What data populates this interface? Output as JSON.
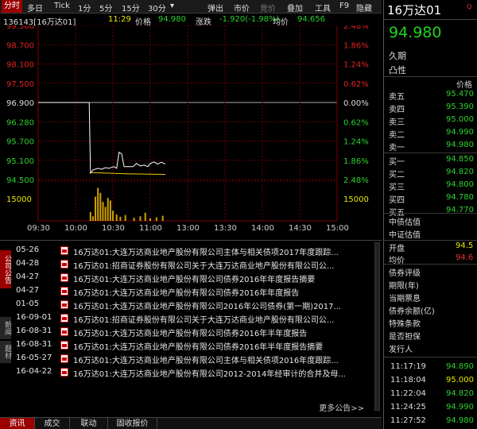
{
  "toolbar": {
    "left": [
      {
        "label": "分时",
        "active": true
      },
      {
        "label": "多日"
      },
      {
        "label": "Tick"
      },
      {
        "label": "1分"
      },
      {
        "label": "5分"
      },
      {
        "label": "15分"
      },
      {
        "label": "30分"
      }
    ],
    "dropdown_symbol": "▾",
    "right": [
      {
        "label": "弹出"
      },
      {
        "label": "市价"
      },
      {
        "label": "竞价"
      },
      {
        "label": "叠加"
      },
      {
        "label": "工具"
      },
      {
        "label": "F9"
      },
      {
        "label": "隐藏"
      }
    ]
  },
  "info": {
    "code": "136143[16万达01]",
    "time": "11:29",
    "price_label": "价格",
    "price_value": "94.980",
    "change_label": "涨跌",
    "change_value": "-1.920(-1.98%)",
    "avg_label": "均价",
    "avg_value": "94.656"
  },
  "chart_data": {
    "type": "line",
    "title": "",
    "x_ticks": [
      "09:30",
      "10:00",
      "10:30",
      "11:00",
      "13:00",
      "13:30",
      "14:00",
      "14:30",
      "15:00"
    ],
    "y_left_ticks": [
      "99.300",
      "98.700",
      "98.100",
      "97.500",
      "96.900",
      "96.280",
      "95.700",
      "95.100",
      "94.500"
    ],
    "y_right_ticks": [
      "2.48%",
      "1.86%",
      "1.24%",
      "0.62%",
      "0.00%",
      "0.62%",
      "1.24%",
      "1.86%",
      "2.48%"
    ],
    "volume_ticks": [
      "15000",
      "15000"
    ],
    "prev_close": 96.9,
    "ylim": [
      94.5,
      99.3
    ],
    "price_series": [
      {
        "t": "09:30",
        "v": 96.9
      },
      {
        "t": "10:11",
        "v": 96.9
      },
      {
        "t": "10:12",
        "v": 94.7
      },
      {
        "t": "10:14",
        "v": 94.8
      },
      {
        "t": "10:18",
        "v": 94.85
      },
      {
        "t": "10:21",
        "v": 94.82
      },
      {
        "t": "10:24",
        "v": 94.87
      },
      {
        "t": "10:27",
        "v": 94.85
      },
      {
        "t": "10:29",
        "v": 94.88
      },
      {
        "t": "10:31",
        "v": 94.9
      },
      {
        "t": "10:33",
        "v": 94.85
      },
      {
        "t": "10:35",
        "v": 95.35
      },
      {
        "t": "10:37",
        "v": 95.3
      },
      {
        "t": "10:39",
        "v": 94.9
      },
      {
        "t": "10:42",
        "v": 94.9
      },
      {
        "t": "10:46",
        "v": 94.9
      },
      {
        "t": "10:49",
        "v": 95.0
      },
      {
        "t": "10:52",
        "v": 94.92
      },
      {
        "t": "10:55",
        "v": 94.95
      },
      {
        "t": "10:58",
        "v": 94.9
      },
      {
        "t": "11:00",
        "v": 95.0
      },
      {
        "t": "11:03",
        "v": 95.05
      },
      {
        "t": "11:06",
        "v": 94.98
      },
      {
        "t": "11:09",
        "v": 95.04
      },
      {
        "t": "11:12",
        "v": 94.98
      }
    ],
    "avg_series": [
      {
        "t": "10:12",
        "v": 94.72
      },
      {
        "t": "10:40",
        "v": 94.68
      },
      {
        "t": "11:12",
        "v": 94.66
      }
    ],
    "volume_bars": [
      {
        "t": "10:12",
        "v": 3500
      },
      {
        "t": "10:14",
        "v": 1800
      },
      {
        "t": "10:16",
        "v": 9500
      },
      {
        "t": "10:18",
        "v": 13000
      },
      {
        "t": "10:20",
        "v": 11000
      },
      {
        "t": "10:22",
        "v": 7500
      },
      {
        "t": "10:24",
        "v": 5500
      },
      {
        "t": "10:26",
        "v": 9000
      },
      {
        "t": "10:28",
        "v": 8000
      },
      {
        "t": "10:30",
        "v": 4000
      },
      {
        "t": "10:33",
        "v": 2500
      },
      {
        "t": "10:36",
        "v": 1600
      },
      {
        "t": "10:40",
        "v": 2300
      },
      {
        "t": "10:47",
        "v": 1200
      },
      {
        "t": "10:52",
        "v": 1800
      },
      {
        "t": "10:56",
        "v": 3200
      },
      {
        "t": "11:00",
        "v": 1000
      },
      {
        "t": "11:05",
        "v": 1400
      },
      {
        "t": "11:10",
        "v": 2000
      }
    ],
    "colors": {
      "price": "#ffffff",
      "avg": "#f0d000",
      "volume": "#d2a000",
      "grid": "#6b0000",
      "up": "#e22222",
      "down": "#2ed12e"
    }
  },
  "news": {
    "side_tabs": [
      {
        "label": "公司公告",
        "active": true
      },
      {
        "label": "新闻",
        "active": false
      },
      {
        "label": "题材",
        "active": false
      }
    ],
    "items": [
      {
        "date": "05-26",
        "title": "16万达01:大连万达商业地产股份有限公司主体与相关债项2017年度跟踪..."
      },
      {
        "date": "04-28",
        "title": "16万达01:招商证券股份有限公司关于大连万达商业地产股份有限公司公..."
      },
      {
        "date": "04-27",
        "title": "16万达01:大连万达商业地产股份有限公司债券2016年年度报告摘要"
      },
      {
        "date": "04-27",
        "title": "16万达01:大连万达商业地产股份有限公司债券2016年年度报告"
      },
      {
        "date": "01-05",
        "title": "16万达01:大连万达商业地产股份有限公司2016年公司债券(第一期)2017..."
      },
      {
        "date": "16-09-01",
        "title": "16万达01:招商证券股份有限公司关于大连万达商业地产股份有限公司公..."
      },
      {
        "date": "16-08-31",
        "title": "16万达01:大连万达商业地产股份有限公司债券2016年半年度报告"
      },
      {
        "date": "16-08-31",
        "title": "16万达01:大连万达商业地产股份有限公司债券2016年半年度报告摘要"
      },
      {
        "date": "16-05-27",
        "title": "16万达01:大连万达商业地产股份有限公司主体与相关债项2016年度跟踪..."
      },
      {
        "date": "16-04-22",
        "title": "16万达01:大连万达商业地产股份有限公司2012-2014年经审计的合并及母..."
      }
    ],
    "more": "更多公告>>"
  },
  "bottom_tabs": [
    {
      "label": "资讯",
      "active": true
    },
    {
      "label": "成交"
    },
    {
      "label": "联动"
    },
    {
      "label": "固收报价"
    }
  ],
  "right": {
    "name": "16万达01",
    "icon": "Q",
    "price": "94.980",
    "period_label": "久期",
    "convexity_label": "凸性",
    "price_header": "价格",
    "asks": [
      {
        "label": "卖五",
        "value": "95.470"
      },
      {
        "label": "卖四",
        "value": "95.390"
      },
      {
        "label": "卖三",
        "value": "95.000"
      },
      {
        "label": "卖二",
        "value": "94.990"
      },
      {
        "label": "卖一",
        "value": "94.980"
      }
    ],
    "bids": [
      {
        "label": "买一",
        "value": "94.850"
      },
      {
        "label": "买二",
        "value": "94.820"
      },
      {
        "label": "买三",
        "value": "94.800"
      },
      {
        "label": "买四",
        "value": "94.780"
      },
      {
        "label": "买五",
        "value": "94.770"
      }
    ],
    "valuations": [
      "中债估值",
      "中证估值"
    ],
    "open_label": "开盘",
    "open_value": "94.5",
    "avg_label": "均价",
    "avg_value": "94.6",
    "props": [
      "债券评级",
      "期限(年)",
      "当期票息",
      "债券余额(亿)",
      "特殊条款",
      "是否担保",
      "发行人"
    ],
    "ticks": [
      {
        "time": "11:17:19",
        "value": "94.890"
      },
      {
        "time": "11:18:04",
        "value": "95.000"
      },
      {
        "time": "11:22:04",
        "value": "94.820"
      },
      {
        "time": "11:24:25",
        "value": "94.990"
      },
      {
        "time": "11:27:52",
        "value": "94.980"
      }
    ]
  }
}
